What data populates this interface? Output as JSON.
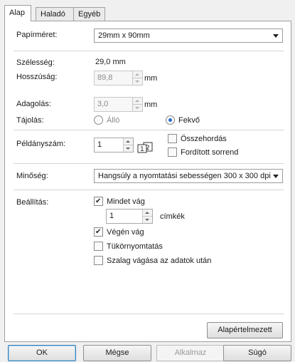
{
  "tabs": [
    {
      "label": "Alap",
      "hotkey": "A"
    },
    {
      "label": "Haladó",
      "hotkey": "H"
    },
    {
      "label": "Egyéb",
      "hotkey": "E"
    }
  ],
  "paper_size": {
    "label": "Papírméret:",
    "value": "29mm x 90mm"
  },
  "width": {
    "label": "Szélesség:",
    "value": "29,0 mm"
  },
  "length": {
    "label": "Hosszúság:",
    "value": "89,8",
    "unit": "mm"
  },
  "feed": {
    "label": "Adagolás:",
    "value": "3,0",
    "unit": "mm"
  },
  "orientation": {
    "label": "Tájolás:",
    "portrait": "Álló",
    "landscape": "Fekvő",
    "selected": "landscape"
  },
  "copies": {
    "label": "Példányszám:",
    "value": "1",
    "collate": "Összehordás",
    "reverse": "Fordított sorrend"
  },
  "quality": {
    "label": "Minőség:",
    "value": "Hangsúly a nyomtatási sebességen 300 x 300 dpi"
  },
  "settings": {
    "label": "Beállítás:",
    "cut_all": "Mindet vág",
    "cut_all_checked": true,
    "labels_value": "1",
    "labels_unit": "címkék",
    "cut_end": "Végén vág",
    "cut_end_checked": true,
    "mirror": "Tükörnyomtatás",
    "mirror_checked": false,
    "cut_after_data": "Szalag vágása az adatok után",
    "cut_after_data_checked": false
  },
  "defaults_button": "Alapértelmezett",
  "footer": {
    "ok": "OK",
    "cancel": "Mégse",
    "apply": "Alkalmaz",
    "help": "Súgó"
  }
}
